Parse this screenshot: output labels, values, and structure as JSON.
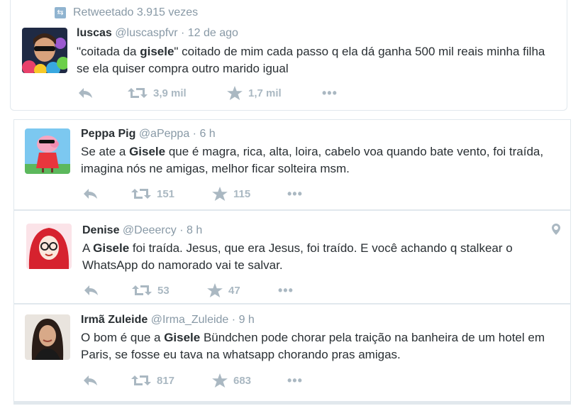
{
  "retweet_context": {
    "label": "Retweetado 3.915 vezes"
  },
  "tweets": [
    {
      "name": "luscas",
      "handle": "@luscaspfvr",
      "time": "12 de ago",
      "text_parts": [
        "\"coitada da ",
        "gisele",
        "\" coitado de mim cada passo q ela dá ganha 500 mil reais minha filha se ela quiser compra outro marido igual"
      ],
      "retweets": "3,9 mil",
      "favorites": "1,7 mil"
    },
    {
      "name": "Peppa Pig",
      "handle": "@aPeppa",
      "time": "6 h",
      "text_parts": [
        "Se ate a ",
        "Gisele",
        " que é magra, rica, alta, loira, cabelo voa quando bate vento, foi traída, imagina nós ne amigas, melhor ficar solteira msm."
      ],
      "retweets": "151",
      "favorites": "115"
    },
    {
      "name": "Denise",
      "handle": "@Deeercy",
      "time": "8 h",
      "text_parts": [
        "A ",
        "Gisele",
        " foi traída. Jesus, que era Jesus, foi traído. E você achando q stalkear o WhatsApp do namorado vai te salvar."
      ],
      "retweets": "53",
      "favorites": "47"
    },
    {
      "name": "Irmã Zuleide",
      "handle": "@Irma_Zuleide",
      "time": "9 h",
      "text_parts": [
        "O bom é que a ",
        "Gisele",
        " Bündchen pode chorar pela traição na banheira de um hotel em Paris, se fosse eu tava na whatsapp chorando pras amigas."
      ],
      "retweets": "817",
      "favorites": "683"
    }
  ],
  "separator": "·",
  "more_glyph": "•••",
  "colors": {
    "muted": "#8899a6",
    "icon": "#aab8c2",
    "text": "#292f33",
    "border": "#e1e8ed"
  },
  "icons": {
    "retweet_context": "retweet-icon",
    "reply": "reply-icon",
    "retweet": "retweet-icon",
    "favorite": "star-icon",
    "more": "more-icon",
    "geo": "location-pin-icon"
  }
}
